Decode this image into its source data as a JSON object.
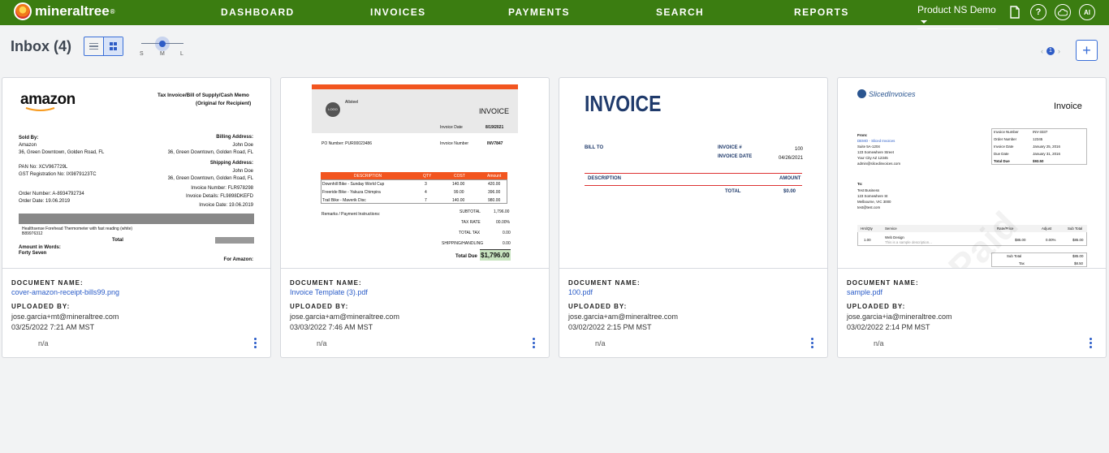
{
  "nav": {
    "brand": "mineraltree",
    "items": [
      "DASHBOARD",
      "INVOICES",
      "PAYMENTS",
      "SEARCH",
      "REPORTS"
    ],
    "tenant": "Product NS Demo",
    "help": "?",
    "user_initials": "AI"
  },
  "toolbar": {
    "title": "Inbox (4)",
    "sizes": [
      "S",
      "M",
      "L"
    ],
    "page": "1",
    "add_label": "+"
  },
  "labels": {
    "document_name": "DOCUMENT NAME:",
    "uploaded_by": "UPLOADED BY:"
  },
  "cards": [
    {
      "name": "cover-amazon-receipt-bills99.png",
      "uploader": "jose.garcia+mt@mineraltree.com",
      "date": "03/25/2022 7:21 AM MST",
      "status": "n/a"
    },
    {
      "name": "Invoice Template (3).pdf",
      "uploader": "jose.garcia+am@mineraltree.com",
      "date": "03/03/2022 7:46 AM MST",
      "status": "n/a"
    },
    {
      "name": "100.pdf",
      "uploader": "jose.garcia+am@mineraltree.com",
      "date": "03/02/2022 2:15 PM MST",
      "status": "n/a"
    },
    {
      "name": "sample.pdf",
      "uploader": "jose.garcia+ia@mineraltree.com",
      "date": "03/02/2022 2:14 PM MST",
      "status": "n/a"
    }
  ],
  "thumbs": {
    "amazon": {
      "logo": "amazon",
      "title": "Tax Invoice/Bill of Supply/Cash Memo",
      "subtitle": "(Original for Recipient)",
      "sold_by": "Sold By:",
      "seller": "Amazon",
      "seller_addr": "36, Green Downtown, Golden Road, FL",
      "billing": "Billing Address:",
      "buyer": "John Doe",
      "buyer_addr": "36, Green Downtown, Golden Road, FL",
      "shipping": "Shipping Address:",
      "pan": "PAN No: XCV967729L",
      "gst": "GST Registration No: IX9879123TC",
      "invoice_number": "Invoice Number: FLR978298",
      "invoice_details": "Invoice Details: FL9898DKEFD",
      "invoice_date": "Invoice Date: 19.06.2019",
      "order_number": "Order Number: A-8934792734",
      "order_date": "Order Date: 19.06.2019",
      "item": "Healthsense Forehead Thermometer with fast reading (white) B89976312",
      "total_label": "Total",
      "amount_words": "Amount in Words:",
      "amount_words_val": "Forty Seven",
      "for_amazon": "For Amazon:"
    },
    "template": {
      "heading": "INVOICE",
      "logo": "LOGO",
      "company": "Allsteel",
      "po": "PO Number: PUR00023486",
      "inv_date_label": "Invoice Date",
      "inv_date": "8/19/2021",
      "inv_num_label": "Invoice Number",
      "inv_num": "INV7847",
      "cols": [
        "DESCRIPTION",
        "QTY",
        "COST",
        "Amount"
      ],
      "rows": [
        [
          "Downhill Bike - Sunday World Cup",
          "3",
          "140.00",
          "420.00"
        ],
        [
          "Freeride Bike - Yakuza Chimpira",
          "4",
          "99.00",
          "396.00"
        ],
        [
          "Trail Bike - Maverik Disc",
          "7",
          "140.00",
          "980.00"
        ]
      ],
      "remarks": "Remarks / Payment Instructions:",
      "subtotal_label": "SUBTOTAL",
      "subtotal": "1,796.00",
      "taxrate_label": "TAX RATE",
      "taxrate": "00.00%",
      "totaltax_label": "TOTAL TAX",
      "totaltax": "0.00",
      "shipping_label": "SHIPPING/HANDLING",
      "shipping": "0.00",
      "total_label": "Total Due",
      "total": "$1,796.00"
    },
    "plain": {
      "heading": "INVOICE",
      "bill_to": "BILL TO",
      "inv_no_label": "INVOICE #",
      "inv_no": "100",
      "inv_date_label": "INVOICE DATE",
      "inv_date": "04/26/2021",
      "desc": "DESCRIPTION",
      "amount": "AMOUNT",
      "total_label": "TOTAL",
      "total": "$0.00"
    },
    "sliced": {
      "brand": "SlicedInvoices",
      "heading": "Invoice",
      "from": "From:",
      "from_lines": [
        "DEMO - Sliced Invoices",
        "Suite 5A-1204",
        "123 Somewhere Street",
        "Your City AZ 12345",
        "admin@slicedinvoices.com"
      ],
      "meta": [
        [
          "Invoice Number",
          "INV-3337"
        ],
        [
          "Order Number",
          "12345"
        ],
        [
          "Invoice Date",
          "January 25, 2016"
        ],
        [
          "Due Date",
          "January 31, 2016"
        ],
        [
          "Total Due",
          "$93.50"
        ]
      ],
      "to": "To:",
      "to_lines": [
        "Test Business",
        "123 Somewhere St",
        "Melbourne, VIC 3000",
        "test@test.com"
      ],
      "cols": [
        "Hrs/Qty",
        "Service",
        "Rate/Price",
        "Adjust",
        "Sub Total"
      ],
      "row": [
        "1.00",
        "Web Design",
        "$85.00",
        "0.00%",
        "$85.00"
      ],
      "row_note": "This is a sample description...",
      "subtotal_label": "Sub Total",
      "subtotal": "$85.00",
      "tax_label": "Tax",
      "tax": "$8.50",
      "stamp": "Paid"
    }
  }
}
